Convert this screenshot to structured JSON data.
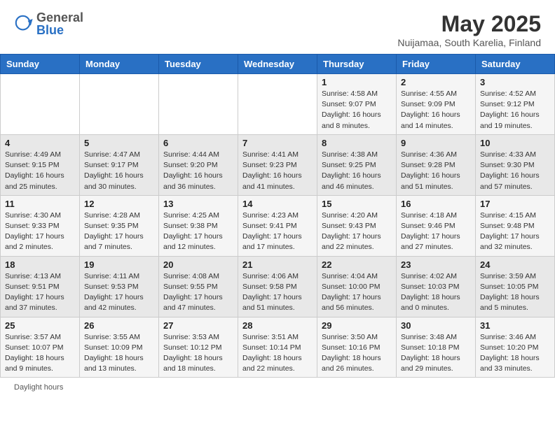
{
  "header": {
    "logo_general": "General",
    "logo_blue": "Blue",
    "month_title": "May 2025",
    "subtitle": "Nuijamaa, South Karelia, Finland"
  },
  "days_of_week": [
    "Sunday",
    "Monday",
    "Tuesday",
    "Wednesday",
    "Thursday",
    "Friday",
    "Saturday"
  ],
  "weeks": [
    [
      {
        "day": "",
        "info": ""
      },
      {
        "day": "",
        "info": ""
      },
      {
        "day": "",
        "info": ""
      },
      {
        "day": "",
        "info": ""
      },
      {
        "day": "1",
        "info": "Sunrise: 4:58 AM\nSunset: 9:07 PM\nDaylight: 16 hours\nand 8 minutes."
      },
      {
        "day": "2",
        "info": "Sunrise: 4:55 AM\nSunset: 9:09 PM\nDaylight: 16 hours\nand 14 minutes."
      },
      {
        "day": "3",
        "info": "Sunrise: 4:52 AM\nSunset: 9:12 PM\nDaylight: 16 hours\nand 19 minutes."
      }
    ],
    [
      {
        "day": "4",
        "info": "Sunrise: 4:49 AM\nSunset: 9:15 PM\nDaylight: 16 hours\nand 25 minutes."
      },
      {
        "day": "5",
        "info": "Sunrise: 4:47 AM\nSunset: 9:17 PM\nDaylight: 16 hours\nand 30 minutes."
      },
      {
        "day": "6",
        "info": "Sunrise: 4:44 AM\nSunset: 9:20 PM\nDaylight: 16 hours\nand 36 minutes."
      },
      {
        "day": "7",
        "info": "Sunrise: 4:41 AM\nSunset: 9:23 PM\nDaylight: 16 hours\nand 41 minutes."
      },
      {
        "day": "8",
        "info": "Sunrise: 4:38 AM\nSunset: 9:25 PM\nDaylight: 16 hours\nand 46 minutes."
      },
      {
        "day": "9",
        "info": "Sunrise: 4:36 AM\nSunset: 9:28 PM\nDaylight: 16 hours\nand 51 minutes."
      },
      {
        "day": "10",
        "info": "Sunrise: 4:33 AM\nSunset: 9:30 PM\nDaylight: 16 hours\nand 57 minutes."
      }
    ],
    [
      {
        "day": "11",
        "info": "Sunrise: 4:30 AM\nSunset: 9:33 PM\nDaylight: 17 hours\nand 2 minutes."
      },
      {
        "day": "12",
        "info": "Sunrise: 4:28 AM\nSunset: 9:35 PM\nDaylight: 17 hours\nand 7 minutes."
      },
      {
        "day": "13",
        "info": "Sunrise: 4:25 AM\nSunset: 9:38 PM\nDaylight: 17 hours\nand 12 minutes."
      },
      {
        "day": "14",
        "info": "Sunrise: 4:23 AM\nSunset: 9:41 PM\nDaylight: 17 hours\nand 17 minutes."
      },
      {
        "day": "15",
        "info": "Sunrise: 4:20 AM\nSunset: 9:43 PM\nDaylight: 17 hours\nand 22 minutes."
      },
      {
        "day": "16",
        "info": "Sunrise: 4:18 AM\nSunset: 9:46 PM\nDaylight: 17 hours\nand 27 minutes."
      },
      {
        "day": "17",
        "info": "Sunrise: 4:15 AM\nSunset: 9:48 PM\nDaylight: 17 hours\nand 32 minutes."
      }
    ],
    [
      {
        "day": "18",
        "info": "Sunrise: 4:13 AM\nSunset: 9:51 PM\nDaylight: 17 hours\nand 37 minutes."
      },
      {
        "day": "19",
        "info": "Sunrise: 4:11 AM\nSunset: 9:53 PM\nDaylight: 17 hours\nand 42 minutes."
      },
      {
        "day": "20",
        "info": "Sunrise: 4:08 AM\nSunset: 9:55 PM\nDaylight: 17 hours\nand 47 minutes."
      },
      {
        "day": "21",
        "info": "Sunrise: 4:06 AM\nSunset: 9:58 PM\nDaylight: 17 hours\nand 51 minutes."
      },
      {
        "day": "22",
        "info": "Sunrise: 4:04 AM\nSunset: 10:00 PM\nDaylight: 17 hours\nand 56 minutes."
      },
      {
        "day": "23",
        "info": "Sunrise: 4:02 AM\nSunset: 10:03 PM\nDaylight: 18 hours\nand 0 minutes."
      },
      {
        "day": "24",
        "info": "Sunrise: 3:59 AM\nSunset: 10:05 PM\nDaylight: 18 hours\nand 5 minutes."
      }
    ],
    [
      {
        "day": "25",
        "info": "Sunrise: 3:57 AM\nSunset: 10:07 PM\nDaylight: 18 hours\nand 9 minutes."
      },
      {
        "day": "26",
        "info": "Sunrise: 3:55 AM\nSunset: 10:09 PM\nDaylight: 18 hours\nand 13 minutes."
      },
      {
        "day": "27",
        "info": "Sunrise: 3:53 AM\nSunset: 10:12 PM\nDaylight: 18 hours\nand 18 minutes."
      },
      {
        "day": "28",
        "info": "Sunrise: 3:51 AM\nSunset: 10:14 PM\nDaylight: 18 hours\nand 22 minutes."
      },
      {
        "day": "29",
        "info": "Sunrise: 3:50 AM\nSunset: 10:16 PM\nDaylight: 18 hours\nand 26 minutes."
      },
      {
        "day": "30",
        "info": "Sunrise: 3:48 AM\nSunset: 10:18 PM\nDaylight: 18 hours\nand 29 minutes."
      },
      {
        "day": "31",
        "info": "Sunrise: 3:46 AM\nSunset: 10:20 PM\nDaylight: 18 hours\nand 33 minutes."
      }
    ]
  ],
  "footer": {
    "daylight_label": "Daylight hours"
  }
}
